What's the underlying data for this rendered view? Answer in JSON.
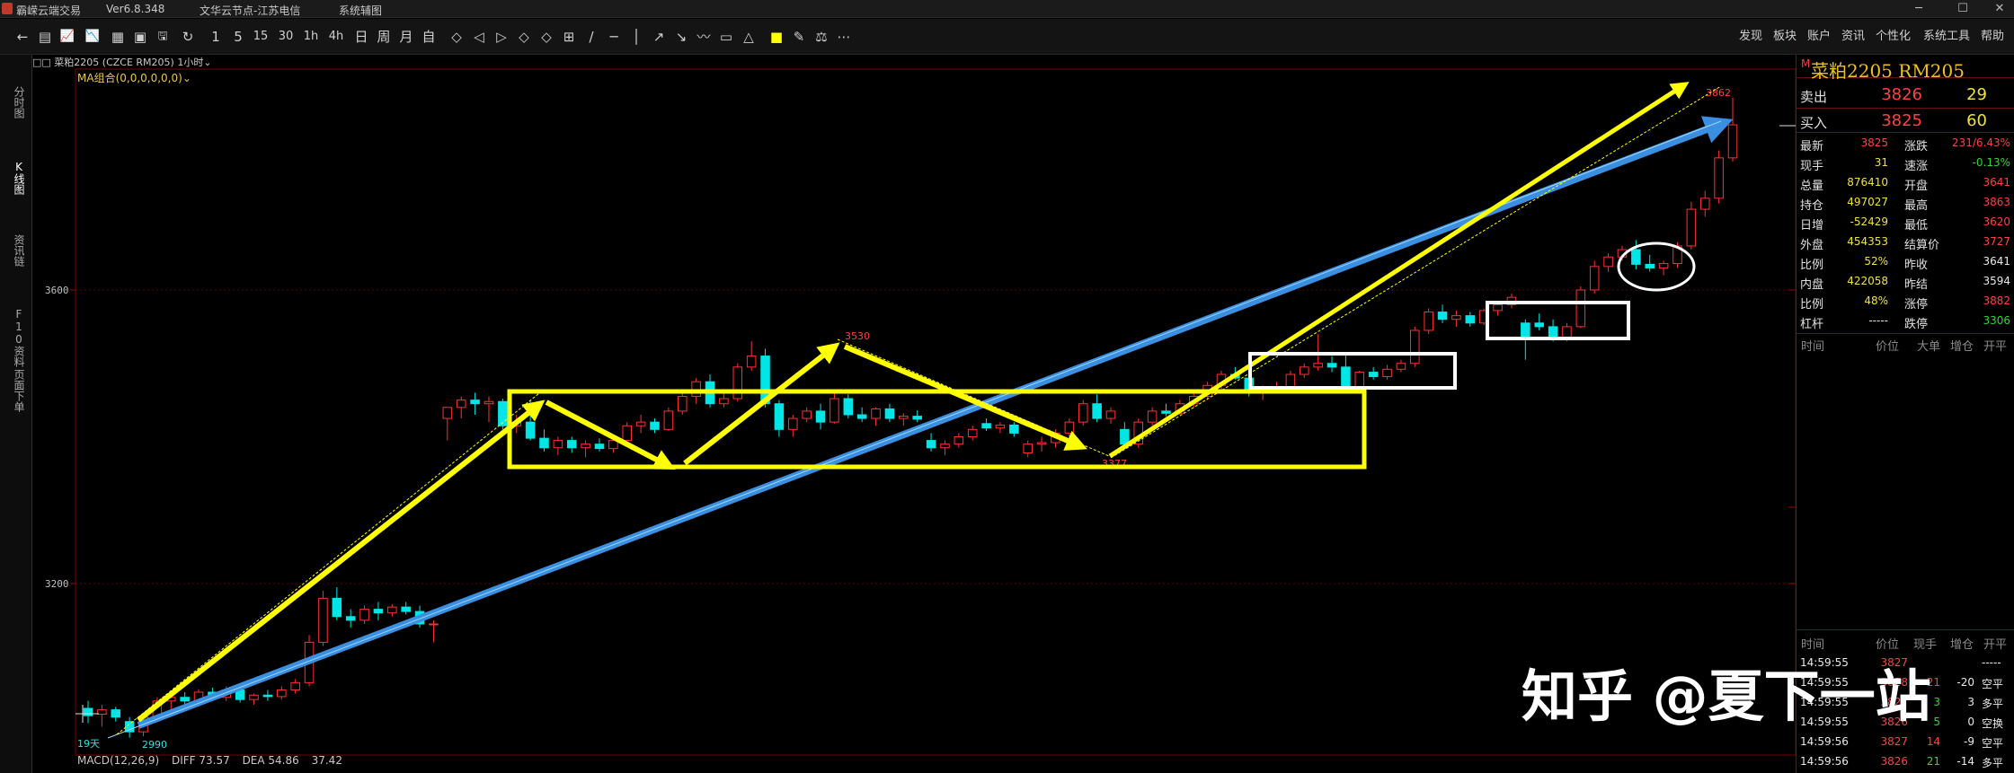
{
  "titlebar": {
    "app_name": "霸嵘云端交易",
    "version": "Ver6.8.348",
    "server": "文华云节点-江苏电信",
    "menu": "系统辅图",
    "controls": [
      "─",
      "☐",
      "✕"
    ]
  },
  "toolbar": {
    "icons": [
      "←",
      "▤",
      "📈",
      "📉",
      "▦",
      "▣",
      "🖫",
      "↻",
      "1",
      "5",
      "15",
      "30",
      "1h",
      "4h",
      "日",
      "周",
      "月",
      "自",
      "◇",
      "◁",
      "▷",
      "◇",
      "◇",
      "⊞",
      "/",
      "─",
      "│",
      "↗",
      "↘",
      "〰",
      "▭",
      "△",
      "■",
      "✎",
      "⚖",
      "⋯"
    ],
    "right_items": [
      "发现",
      "板块",
      "账户",
      "资讯",
      "个性化",
      "系统工具",
      "帮助"
    ]
  },
  "left_tabs": [
    "分时图",
    "K线图",
    "资讯链",
    "F10资料",
    "页面下单"
  ],
  "chart_header": {
    "symbol": "□□ 菜粕2205",
    "market": "(CZCE RM205)",
    "period": "1小时",
    "indicator": "MA组合(0,0,0,0,0,0)"
  },
  "chart_data": {
    "type": "candlestick",
    "price_ticks": [
      {
        "price": 3600,
        "label": "3600"
      },
      {
        "price": 3200,
        "label": "3200"
      }
    ],
    "candles": [
      {
        "o": 3030,
        "h": 3040,
        "l": 3010,
        "c": 3020,
        "up": false
      },
      {
        "o": 3022,
        "h": 3035,
        "l": 3005,
        "c": 3028,
        "up": true
      },
      {
        "o": 3028,
        "h": 3032,
        "l": 3012,
        "c": 3018,
        "up": false
      },
      {
        "o": 3012,
        "h": 3018,
        "l": 2990,
        "c": 2998,
        "up": false
      },
      {
        "o": 2998,
        "h": 3022,
        "l": 2992,
        "c": 3018,
        "up": true
      },
      {
        "o": 3018,
        "h": 3045,
        "l": 3015,
        "c": 3040,
        "up": true
      },
      {
        "o": 3040,
        "h": 3048,
        "l": 3028,
        "c": 3045,
        "up": true
      },
      {
        "o": 3045,
        "h": 3052,
        "l": 3035,
        "c": 3040,
        "up": false
      },
      {
        "o": 3040,
        "h": 3056,
        "l": 3036,
        "c": 3052,
        "up": true
      },
      {
        "o": 3052,
        "h": 3058,
        "l": 3040,
        "c": 3045,
        "up": false
      },
      {
        "o": 3045,
        "h": 3060,
        "l": 3040,
        "c": 3055,
        "up": true
      },
      {
        "o": 3055,
        "h": 3062,
        "l": 3038,
        "c": 3042,
        "up": false
      },
      {
        "o": 3042,
        "h": 3050,
        "l": 3035,
        "c": 3048,
        "up": true
      },
      {
        "o": 3048,
        "h": 3055,
        "l": 3040,
        "c": 3046,
        "up": false
      },
      {
        "o": 3046,
        "h": 3060,
        "l": 3042,
        "c": 3055,
        "up": true
      },
      {
        "o": 3055,
        "h": 3070,
        "l": 3050,
        "c": 3065,
        "up": true
      },
      {
        "o": 3065,
        "h": 3130,
        "l": 3060,
        "c": 3120,
        "up": true
      },
      {
        "o": 3120,
        "h": 3190,
        "l": 3115,
        "c": 3180,
        "up": true
      },
      {
        "o": 3180,
        "h": 3195,
        "l": 3150,
        "c": 3155,
        "up": false
      },
      {
        "o": 3155,
        "h": 3165,
        "l": 3140,
        "c": 3150,
        "up": false
      },
      {
        "o": 3150,
        "h": 3170,
        "l": 3145,
        "c": 3165,
        "up": true
      },
      {
        "o": 3165,
        "h": 3175,
        "l": 3150,
        "c": 3160,
        "up": false
      },
      {
        "o": 3160,
        "h": 3172,
        "l": 3155,
        "c": 3168,
        "up": true
      },
      {
        "o": 3168,
        "h": 3175,
        "l": 3158,
        "c": 3162,
        "up": false
      },
      {
        "o": 3162,
        "h": 3170,
        "l": 3140,
        "c": 3145,
        "up": false
      },
      {
        "o": 3145,
        "h": 3150,
        "l": 3120,
        "c": 3145,
        "up": true
      },
      {
        "o": 3425,
        "h": 3440,
        "l": 3395,
        "c": 3440,
        "up": true
      },
      {
        "o": 3440,
        "h": 3455,
        "l": 3425,
        "c": 3450,
        "up": true
      },
      {
        "o": 3450,
        "h": 3460,
        "l": 3430,
        "c": 3445,
        "up": false
      },
      {
        "o": 3445,
        "h": 3455,
        "l": 3420,
        "c": 3448,
        "up": true
      },
      {
        "o": 3448,
        "h": 3452,
        "l": 3410,
        "c": 3415,
        "up": false
      },
      {
        "o": 3415,
        "h": 3430,
        "l": 3405,
        "c": 3420,
        "up": true
      },
      {
        "o": 3420,
        "h": 3450,
        "l": 3395,
        "c": 3398,
        "up": false
      },
      {
        "o": 3398,
        "h": 3410,
        "l": 3380,
        "c": 3385,
        "up": false
      },
      {
        "o": 3385,
        "h": 3400,
        "l": 3375,
        "c": 3395,
        "up": true
      },
      {
        "o": 3395,
        "h": 3400,
        "l": 3378,
        "c": 3385,
        "up": false
      },
      {
        "o": 3385,
        "h": 3395,
        "l": 3372,
        "c": 3390,
        "up": true
      },
      {
        "o": 3390,
        "h": 3398,
        "l": 3380,
        "c": 3384,
        "up": false
      },
      {
        "o": 3384,
        "h": 3400,
        "l": 3378,
        "c": 3395,
        "up": true
      },
      {
        "o": 3395,
        "h": 3420,
        "l": 3390,
        "c": 3415,
        "up": true
      },
      {
        "o": 3415,
        "h": 3430,
        "l": 3405,
        "c": 3420,
        "up": true
      },
      {
        "o": 3420,
        "h": 3425,
        "l": 3405,
        "c": 3410,
        "up": false
      },
      {
        "o": 3410,
        "h": 3440,
        "l": 3408,
        "c": 3435,
        "up": true
      },
      {
        "o": 3435,
        "h": 3460,
        "l": 3430,
        "c": 3455,
        "up": true
      },
      {
        "o": 3455,
        "h": 3480,
        "l": 3445,
        "c": 3475,
        "up": true
      },
      {
        "o": 3475,
        "h": 3485,
        "l": 3440,
        "c": 3445,
        "up": false
      },
      {
        "o": 3445,
        "h": 3460,
        "l": 3440,
        "c": 3452,
        "up": true
      },
      {
        "o": 3452,
        "h": 3500,
        "l": 3448,
        "c": 3495,
        "up": true
      },
      {
        "o": 3495,
        "h": 3530,
        "l": 3490,
        "c": 3510,
        "up": true
      },
      {
        "o": 3510,
        "h": 3520,
        "l": 3440,
        "c": 3445,
        "up": false
      },
      {
        "o": 3445,
        "h": 3450,
        "l": 3400,
        "c": 3410,
        "up": false
      },
      {
        "o": 3410,
        "h": 3430,
        "l": 3400,
        "c": 3425,
        "up": true
      },
      {
        "o": 3425,
        "h": 3440,
        "l": 3420,
        "c": 3435,
        "up": true
      },
      {
        "o": 3435,
        "h": 3445,
        "l": 3410,
        "c": 3420,
        "up": false
      },
      {
        "o": 3420,
        "h": 3460,
        "l": 3418,
        "c": 3452,
        "up": true
      },
      {
        "o": 3452,
        "h": 3458,
        "l": 3425,
        "c": 3430,
        "up": false
      },
      {
        "o": 3430,
        "h": 3440,
        "l": 3420,
        "c": 3425,
        "up": false
      },
      {
        "o": 3425,
        "h": 3440,
        "l": 3415,
        "c": 3438,
        "up": true
      },
      {
        "o": 3438,
        "h": 3445,
        "l": 3420,
        "c": 3425,
        "up": false
      },
      {
        "o": 3425,
        "h": 3432,
        "l": 3415,
        "c": 3428,
        "up": true
      },
      {
        "o": 3428,
        "h": 3436,
        "l": 3420,
        "c": 3424,
        "up": false
      },
      {
        "o": 3395,
        "h": 3405,
        "l": 3380,
        "c": 3385,
        "up": false
      },
      {
        "o": 3385,
        "h": 3395,
        "l": 3375,
        "c": 3390,
        "up": true
      },
      {
        "o": 3390,
        "h": 3405,
        "l": 3385,
        "c": 3400,
        "up": true
      },
      {
        "o": 3400,
        "h": 3415,
        "l": 3395,
        "c": 3410,
        "up": true
      },
      {
        "o": 3418,
        "h": 3425,
        "l": 3408,
        "c": 3412,
        "up": false
      },
      {
        "o": 3412,
        "h": 3420,
        "l": 3405,
        "c": 3416,
        "up": true
      },
      {
        "o": 3416,
        "h": 3420,
        "l": 3400,
        "c": 3405,
        "up": false
      },
      {
        "o": 3378,
        "h": 3395,
        "l": 3372,
        "c": 3390,
        "up": true
      },
      {
        "o": 3390,
        "h": 3400,
        "l": 3380,
        "c": 3392,
        "up": true
      },
      {
        "o": 3392,
        "h": 3410,
        "l": 3385,
        "c": 3405,
        "up": true
      },
      {
        "o": 3405,
        "h": 3425,
        "l": 3400,
        "c": 3420,
        "up": true
      },
      {
        "o": 3420,
        "h": 3450,
        "l": 3415,
        "c": 3445,
        "up": true
      },
      {
        "o": 3445,
        "h": 3458,
        "l": 3420,
        "c": 3425,
        "up": false
      },
      {
        "o": 3425,
        "h": 3440,
        "l": 3418,
        "c": 3435,
        "up": true
      },
      {
        "o": 3410,
        "h": 3420,
        "l": 3385,
        "c": 3390,
        "up": false
      },
      {
        "o": 3390,
        "h": 3425,
        "l": 3385,
        "c": 3420,
        "up": true
      },
      {
        "o": 3420,
        "h": 3440,
        "l": 3415,
        "c": 3435,
        "up": true
      },
      {
        "o": 3435,
        "h": 3445,
        "l": 3428,
        "c": 3432,
        "up": false
      },
      {
        "o": 3432,
        "h": 3450,
        "l": 3430,
        "c": 3445,
        "up": true
      },
      {
        "o": 3445,
        "h": 3460,
        "l": 3440,
        "c": 3455,
        "up": true
      },
      {
        "o": 3455,
        "h": 3475,
        "l": 3450,
        "c": 3470,
        "up": true
      },
      {
        "o": 3470,
        "h": 3490,
        "l": 3465,
        "c": 3485,
        "up": true
      },
      {
        "o": 3485,
        "h": 3495,
        "l": 3478,
        "c": 3480,
        "up": false
      },
      {
        "o": 3480,
        "h": 3490,
        "l": 3455,
        "c": 3460,
        "up": false
      },
      {
        "o": 3460,
        "h": 3470,
        "l": 3450,
        "c": 3465,
        "up": true
      },
      {
        "o": 3465,
        "h": 3475,
        "l": 3460,
        "c": 3468,
        "up": true
      },
      {
        "o": 3468,
        "h": 3490,
        "l": 3462,
        "c": 3485,
        "up": true
      },
      {
        "o": 3485,
        "h": 3500,
        "l": 3480,
        "c": 3495,
        "up": true
      },
      {
        "o": 3495,
        "h": 3540,
        "l": 3490,
        "c": 3500,
        "up": true
      },
      {
        "o": 3500,
        "h": 3510,
        "l": 3488,
        "c": 3495,
        "up": false
      },
      {
        "o": 3495,
        "h": 3515,
        "l": 3460,
        "c": 3465,
        "up": false
      },
      {
        "o": 3465,
        "h": 3490,
        "l": 3462,
        "c": 3488,
        "up": true
      },
      {
        "o": 3488,
        "h": 3495,
        "l": 3478,
        "c": 3482,
        "up": false
      },
      {
        "o": 3482,
        "h": 3498,
        "l": 3478,
        "c": 3492,
        "up": true
      },
      {
        "o": 3492,
        "h": 3505,
        "l": 3488,
        "c": 3500,
        "up": true
      },
      {
        "o": 3500,
        "h": 3550,
        "l": 3495,
        "c": 3545,
        "up": true
      },
      {
        "o": 3545,
        "h": 3575,
        "l": 3540,
        "c": 3570,
        "up": true
      },
      {
        "o": 3570,
        "h": 3580,
        "l": 3555,
        "c": 3560,
        "up": false
      },
      {
        "o": 3560,
        "h": 3572,
        "l": 3550,
        "c": 3565,
        "up": true
      },
      {
        "o": 3565,
        "h": 3570,
        "l": 3550,
        "c": 3555,
        "up": false
      },
      {
        "o": 3555,
        "h": 3575,
        "l": 3552,
        "c": 3572,
        "up": true
      },
      {
        "o": 3572,
        "h": 3585,
        "l": 3565,
        "c": 3580,
        "up": true
      },
      {
        "o": 3580,
        "h": 3595,
        "l": 3575,
        "c": 3590,
        "up": true
      },
      {
        "o": 3535,
        "h": 3560,
        "l": 3505,
        "c": 3555,
        "up": false
      },
      {
        "o": 3555,
        "h": 3568,
        "l": 3545,
        "c": 3550,
        "up": false
      },
      {
        "o": 3550,
        "h": 3560,
        "l": 3530,
        "c": 3535,
        "up": false
      },
      {
        "o": 3535,
        "h": 3555,
        "l": 3530,
        "c": 3550,
        "up": true
      },
      {
        "o": 3550,
        "h": 3605,
        "l": 3548,
        "c": 3600,
        "up": true
      },
      {
        "o": 3600,
        "h": 3640,
        "l": 3595,
        "c": 3632,
        "up": true
      },
      {
        "o": 3632,
        "h": 3650,
        "l": 3625,
        "c": 3645,
        "up": true
      },
      {
        "o": 3645,
        "h": 3660,
        "l": 3640,
        "c": 3655,
        "up": true
      },
      {
        "o": 3655,
        "h": 3668,
        "l": 3628,
        "c": 3635,
        "up": false
      },
      {
        "o": 3635,
        "h": 3648,
        "l": 3625,
        "c": 3630,
        "up": false
      },
      {
        "o": 3630,
        "h": 3640,
        "l": 3620,
        "c": 3636,
        "up": true
      },
      {
        "o": 3636,
        "h": 3665,
        "l": 3630,
        "c": 3660,
        "up": true
      },
      {
        "o": 3660,
        "h": 3720,
        "l": 3655,
        "c": 3710,
        "up": true
      },
      {
        "o": 3710,
        "h": 3735,
        "l": 3700,
        "c": 3725,
        "up": true
      },
      {
        "o": 3725,
        "h": 3790,
        "l": 3718,
        "c": 3780,
        "up": true
      },
      {
        "o": 3780,
        "h": 3862,
        "l": 3775,
        "c": 3825,
        "up": true
      }
    ],
    "annotations": [
      {
        "price": 2990,
        "label": "2990"
      },
      {
        "price": 3530,
        "label": "3530"
      },
      {
        "price": 3862,
        "label": "3862"
      },
      {
        "price": 3377,
        "label": "3377"
      }
    ],
    "bottom_left_label": "19天"
  },
  "macd": {
    "label": "MACD(12,26,9)",
    "diff": "DIFF 73.57",
    "dea": "DEA 54.86",
    "macd": "37.42"
  },
  "quote": {
    "marker": "M",
    "name": "菜粕2205 RM205",
    "sell_label": "卖出",
    "sell_price": "3826",
    "sell_vol": "29",
    "buy_label": "买入",
    "buy_price": "3825",
    "buy_vol": "60",
    "rows": [
      {
        "k1": "最新",
        "v1": "3825",
        "c1": "red",
        "k2": "涨跌",
        "v2": "231/6.43%",
        "c2": "red"
      },
      {
        "k1": "现手",
        "v1": "31",
        "c1": "yel",
        "k2": "速涨",
        "v2": "-0.13%",
        "c2": "grn"
      },
      {
        "k1": "总量",
        "v1": "876410",
        "c1": "yel",
        "k2": "开盘",
        "v2": "3641",
        "c2": "red"
      },
      {
        "k1": "持仓",
        "v1": "497027",
        "c1": "yel",
        "k2": "最高",
        "v2": "3863",
        "c2": "red"
      },
      {
        "k1": "日增",
        "v1": "-52429",
        "c1": "yel",
        "k2": "最低",
        "v2": "3620",
        "c2": "red"
      },
      {
        "k1": "外盘",
        "v1": "454353",
        "c1": "yel",
        "k2": "结算价",
        "v2": "3727",
        "c2": "red"
      },
      {
        "k1": "比例",
        "v1": "52%",
        "c1": "yel",
        "k2": "昨收",
        "v2": "3641",
        "c2": "wht"
      },
      {
        "k1": "内盘",
        "v1": "422058",
        "c1": "yel",
        "k2": "昨结",
        "v2": "3594",
        "c2": "wht"
      },
      {
        "k1": "比例",
        "v1": "48%",
        "c1": "yel",
        "k2": "涨停",
        "v2": "3882",
        "c2": "red"
      },
      {
        "k1": "杠杆",
        "v1": "-----",
        "c1": "wht",
        "k2": "跌停",
        "v2": "3306",
        "c2": "grn"
      }
    ],
    "header1": [
      "时间",
      "价位",
      "大单",
      "增仓",
      "开平"
    ],
    "header2": [
      "时间",
      "价位",
      "现手",
      "增仓",
      "开平"
    ],
    "ticks": [
      {
        "t": "14:59:55",
        "p": "3827",
        "pc": "red",
        "v": "",
        "vc": "red",
        "d": "",
        "e": "-----"
      },
      {
        "t": "14:59:55",
        "p": "3828",
        "pc": "red",
        "v": "21",
        "vc": "red",
        "d": "-20",
        "e": "空平"
      },
      {
        "t": "14:59:55",
        "p": "3827",
        "pc": "red",
        "v": "3",
        "vc": "grn",
        "d": "3",
        "e": "多平"
      },
      {
        "t": "14:59:55",
        "p": "3826",
        "pc": "red",
        "v": "5",
        "vc": "grn",
        "d": "0",
        "e": "空换"
      },
      {
        "t": "14:59:56",
        "p": "3827",
        "pc": "red",
        "v": "14",
        "vc": "red",
        "d": "-9",
        "e": "空平"
      },
      {
        "t": "14:59:56",
        "p": "3826",
        "pc": "red",
        "v": "21",
        "vc": "grn",
        "d": "-14",
        "e": "多平"
      }
    ]
  },
  "watermark": "知乎 @夏下一站",
  "colors": {
    "up": "#ff3030",
    "down": "#00e5e5",
    "arrow_yellow": "#ffff00",
    "arrow_blue": "#3b8fe0",
    "box_yellow": "#ffff00",
    "box_white": "#ffffff"
  }
}
